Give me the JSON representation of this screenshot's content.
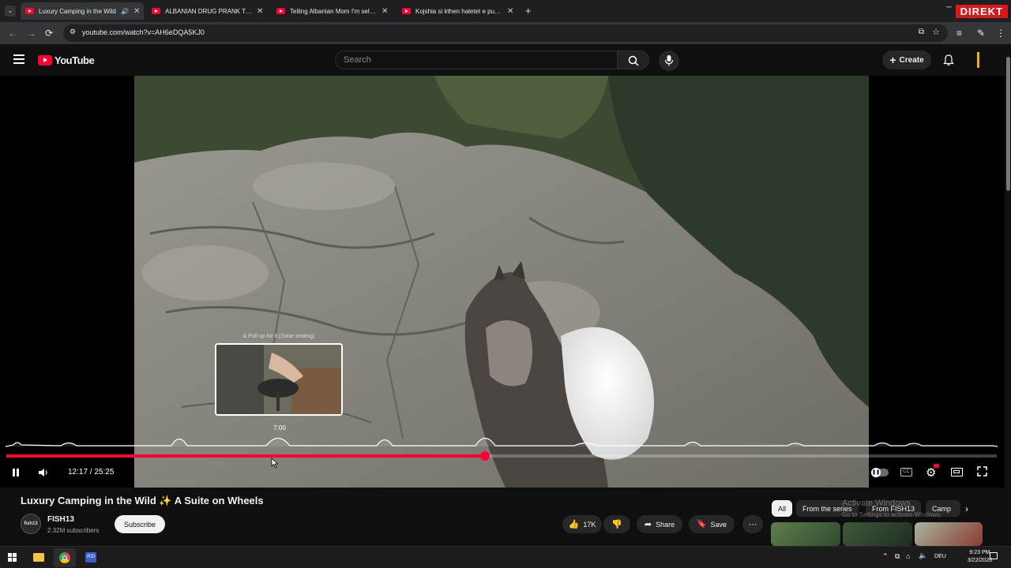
{
  "browser": {
    "tabs": [
      {
        "title": "Luxury Camping in the Wild",
        "active": true
      },
      {
        "title": "ALBANIAN DRUG PRANK TO FAMILY",
        "active": false
      },
      {
        "title": "Telling Albanian Mom I'm selling",
        "active": false
      },
      {
        "title": "Kojshia si kthen haletet e punes",
        "active": false
      }
    ],
    "url": "youtube.com/watch?v=AH6eDQA5KJ0",
    "corner_badge": "DIREKT"
  },
  "yt": {
    "logo_text": "YouTube",
    "search_placeholder": "Search",
    "create_label": "Create"
  },
  "player": {
    "chapter_label": "& Pull up for it (Solar seating)",
    "hover_time": "7:00",
    "time_display": "12:17 / 25:25",
    "progress": 0.483
  },
  "video": {
    "title": "Luxury Camping in the Wild ✨ A Suite on Wheels",
    "channel": "FISH13",
    "subscribers": "2.32M subscribers",
    "subscribe_label": "Subscribe",
    "avatar_text": "fish13",
    "likes": "17K",
    "share_label": "Share",
    "save_label": "Save"
  },
  "related_chips": [
    "All",
    "From the series",
    "From FISH13",
    "Camp"
  ],
  "watermark": {
    "line1": "Activate Windows",
    "line2": "Go to Settings to activate Windows."
  },
  "taskbar": {
    "lang": "DEU",
    "time": "9:23 PM",
    "date": "3/22/2026"
  },
  "colors": {
    "accent": "#ff0033",
    "background": "#0f0f0f"
  }
}
